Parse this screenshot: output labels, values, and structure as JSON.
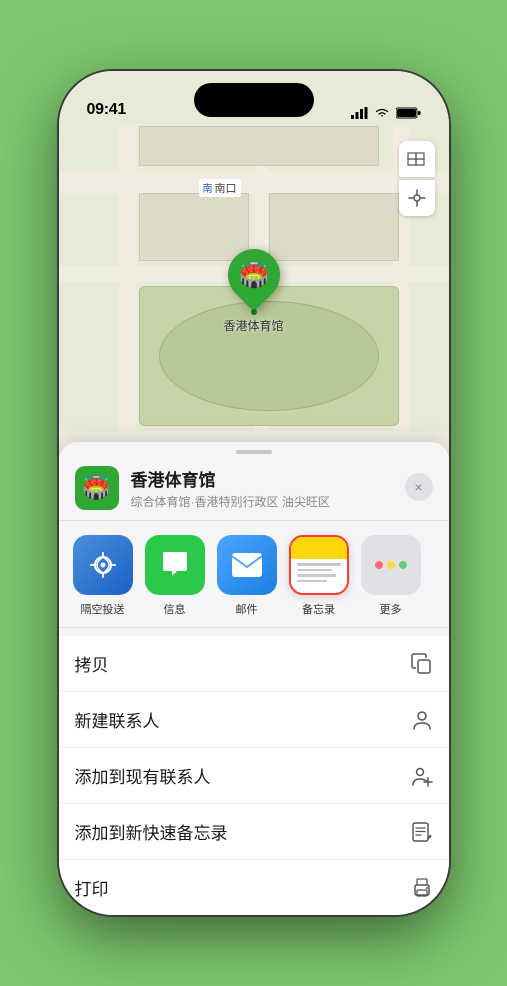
{
  "status_bar": {
    "time": "09:41",
    "location_arrow": "▲"
  },
  "map": {
    "gate_direction": "南",
    "gate_label": "南口",
    "pin_label": "香港体育馆"
  },
  "venue": {
    "name": "香港体育馆",
    "subtitle": "综合体育馆·香港特别行政区 油尖旺区",
    "logo_emoji": "🏟️",
    "close_label": "×"
  },
  "share_items": [
    {
      "key": "airdrop",
      "label": "隔空投送",
      "emoji": "📡"
    },
    {
      "key": "messages",
      "label": "信息",
      "emoji": "💬"
    },
    {
      "key": "mail",
      "label": "邮件",
      "emoji": "✉️"
    },
    {
      "key": "notes",
      "label": "备忘录",
      "emoji": ""
    }
  ],
  "actions": [
    {
      "label": "拷贝",
      "icon": "copy"
    },
    {
      "label": "新建联系人",
      "icon": "person"
    },
    {
      "label": "添加到现有联系人",
      "icon": "person-add"
    },
    {
      "label": "添加到新快速备忘录",
      "icon": "note"
    },
    {
      "label": "打印",
      "icon": "print"
    }
  ],
  "colors": {
    "green": "#2ea832",
    "red_outline": "#ff3b30",
    "notes_yellow": "#ffd60a"
  }
}
